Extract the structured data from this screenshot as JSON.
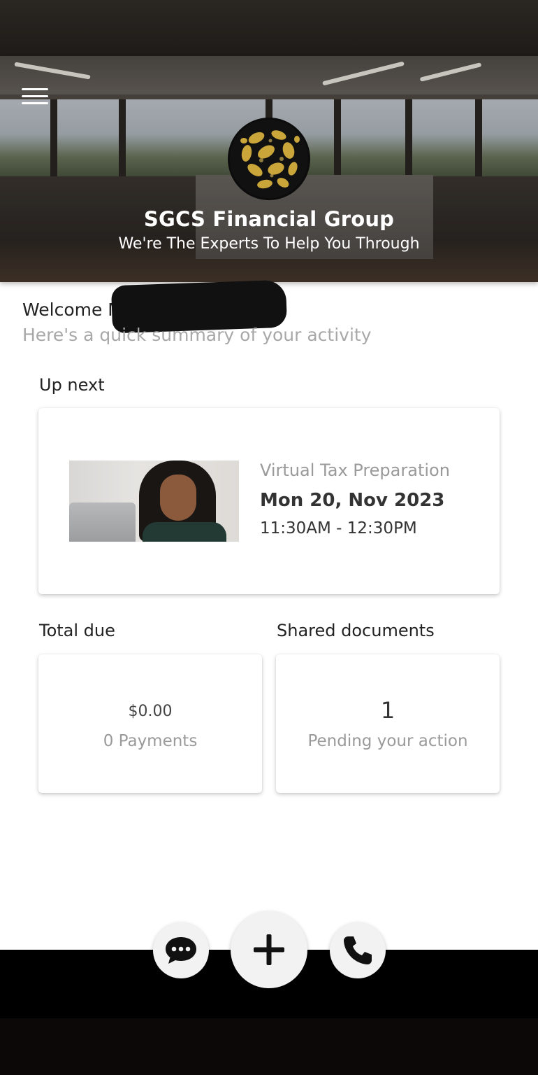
{
  "header": {
    "brand_title": "SGCS Financial Group",
    "brand_subtitle": "We're The Experts To Help You Through"
  },
  "welcome": {
    "greeting": "Welcome M",
    "summary": "Here's a quick summary of your activity"
  },
  "up_next": {
    "section_label": "Up next",
    "service": "Virtual Tax Preparation",
    "date": "Mon 20, Nov 2023",
    "time": "11:30AM - 12:30PM"
  },
  "total_due": {
    "section_label": "Total due",
    "amount": "$0.00",
    "payments": "0 Payments"
  },
  "shared_documents": {
    "section_label": "Shared documents",
    "count": "1",
    "status": "Pending your action"
  },
  "actions": [
    {
      "icon": "chat-icon"
    },
    {
      "icon": "plus-icon"
    },
    {
      "icon": "phone-icon"
    }
  ],
  "colors": {
    "logo_gold": "#c9a53a",
    "muted_text": "#9a9a9a",
    "fab_bg": "#f2f2f2"
  }
}
